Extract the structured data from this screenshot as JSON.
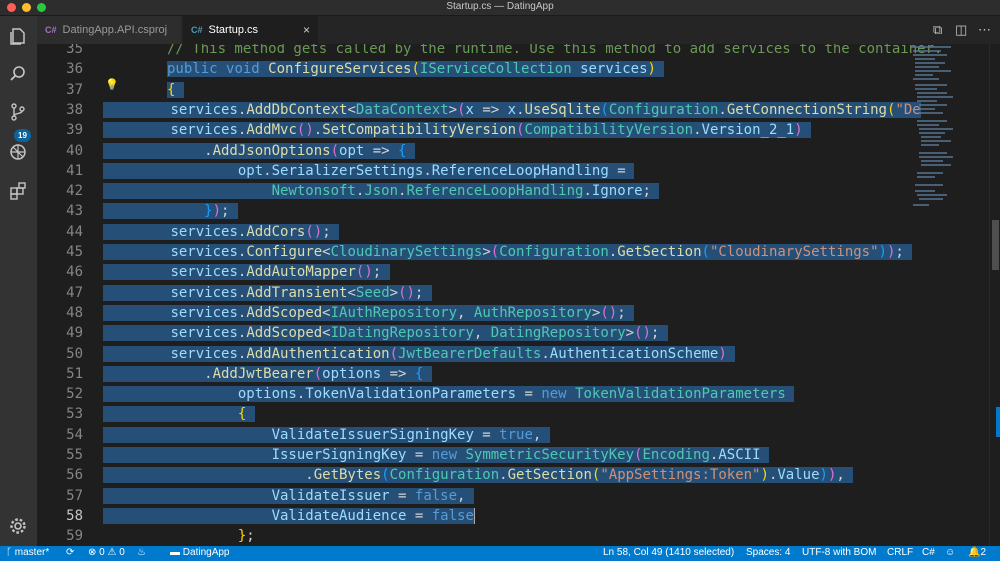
{
  "window": {
    "title": "Startup.cs — DatingApp"
  },
  "activity": {
    "scm_badge": "19"
  },
  "tabs": [
    {
      "icon": "C#",
      "label": "DatingApp.API.csproj"
    },
    {
      "icon": "C#",
      "label": "Startup.cs",
      "close": "×"
    }
  ],
  "editor": {
    "lines": [
      {
        "n": "35"
      },
      {
        "n": "36"
      },
      {
        "n": "37"
      },
      {
        "n": "38"
      },
      {
        "n": "39"
      },
      {
        "n": "40"
      },
      {
        "n": "41"
      },
      {
        "n": "42"
      },
      {
        "n": "43"
      },
      {
        "n": "44"
      },
      {
        "n": "45"
      },
      {
        "n": "46"
      },
      {
        "n": "47"
      },
      {
        "n": "48"
      },
      {
        "n": "49"
      },
      {
        "n": "50"
      },
      {
        "n": "51"
      },
      {
        "n": "52"
      },
      {
        "n": "53"
      },
      {
        "n": "54"
      },
      {
        "n": "55"
      },
      {
        "n": "56"
      },
      {
        "n": "57"
      },
      {
        "n": "58"
      },
      {
        "n": "59"
      }
    ]
  },
  "status": {
    "branch": "master*",
    "errors": "0",
    "warnings": "0",
    "project": "DatingApp",
    "cursor": "Ln 58, Col 49 (1410 selected)",
    "spaces": "Spaces: 4",
    "encoding": "UTF-8 with BOM",
    "eol": "CRLF",
    "language": "C#",
    "notifications": "2"
  },
  "colors": {
    "accent": "#007acc",
    "selection": "#264f78",
    "background": "#1e1e1e"
  }
}
